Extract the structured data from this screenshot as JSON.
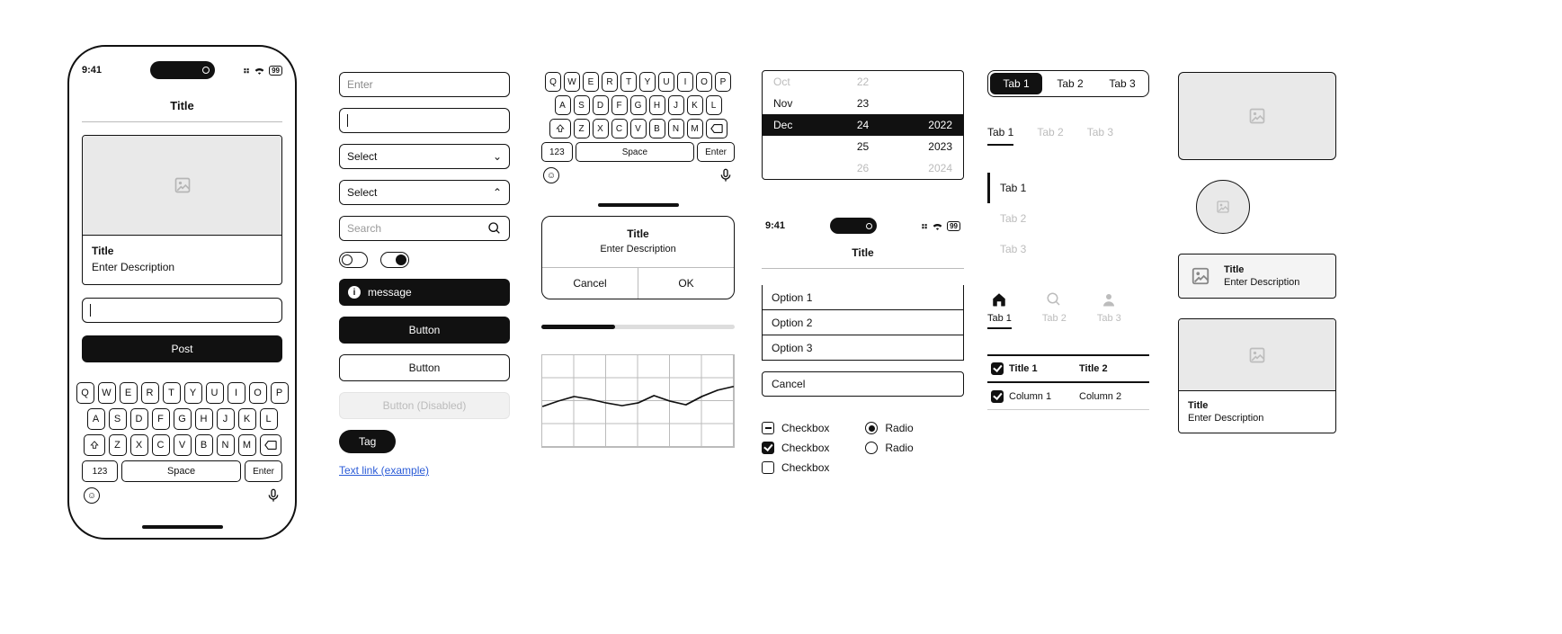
{
  "status_bar": {
    "time": "9:41",
    "battery_label": "99"
  },
  "phone": {
    "title": "Title",
    "card": {
      "title": "Title",
      "description": "Enter Description"
    },
    "post_button": "Post"
  },
  "keyboard": {
    "row1": [
      "Q",
      "W",
      "E",
      "R",
      "T",
      "Y",
      "U",
      "I",
      "O",
      "P"
    ],
    "row2": [
      "A",
      "S",
      "D",
      "F",
      "G",
      "H",
      "J",
      "K",
      "L"
    ],
    "row3_mid": [
      "Z",
      "X",
      "C",
      "V",
      "B",
      "N",
      "M"
    ],
    "num_key": "123",
    "space_key": "Space",
    "enter_key": "Enter"
  },
  "inputs": {
    "enter_placeholder": "Enter",
    "select_down": "Select",
    "select_up": "Select",
    "search_placeholder": "Search"
  },
  "message_bar": "message",
  "buttons": {
    "primary": "Button",
    "secondary": "Button",
    "disabled": "Button (Disabled)",
    "tag": "Tag"
  },
  "text_link": "Text link (example)",
  "dialog": {
    "title": "Title",
    "description": "Enter Description",
    "cancel": "Cancel",
    "ok": "OK"
  },
  "date_picker": {
    "rows": [
      {
        "m": "Oct",
        "d": "22",
        "y": ""
      },
      {
        "m": "Nov",
        "d": "23",
        "y": ""
      },
      {
        "m": "Dec",
        "d": "24",
        "y": "2022"
      },
      {
        "m": "",
        "d": "25",
        "y": "2023"
      },
      {
        "m": "",
        "d": "26",
        "y": "2024"
      }
    ],
    "selected_index": 2
  },
  "standalone_title": "Title",
  "options": {
    "opt1": "Option 1",
    "opt2": "Option 2",
    "opt3": "Option 3",
    "cancel": "Cancel"
  },
  "checkbox_label": "Checkbox",
  "radio_label": "Radio",
  "tabs": {
    "t1": "Tab 1",
    "t2": "Tab 2",
    "t3": "Tab 3"
  },
  "table": {
    "h1": "Title 1",
    "h2": "Title 2",
    "c1": "Column 1",
    "c2": "Column 2"
  },
  "cards": {
    "title": "Title",
    "description": "Enter Description"
  },
  "chart_data": {
    "type": "line",
    "x": [
      0,
      1,
      2,
      3,
      4,
      5,
      6,
      7,
      8,
      9,
      10,
      11,
      12
    ],
    "y": [
      44,
      50,
      55,
      52,
      48,
      45,
      48,
      56,
      50,
      46,
      55,
      62,
      66
    ],
    "xlim": [
      0,
      12
    ],
    "ylim": [
      0,
      100
    ],
    "title": "",
    "xlabel": "",
    "ylabel": ""
  }
}
